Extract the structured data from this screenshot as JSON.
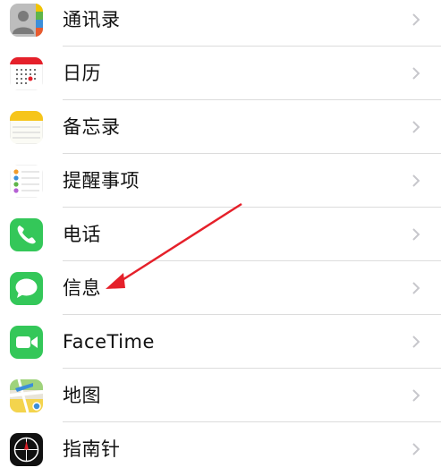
{
  "settings": {
    "items": [
      {
        "label": "通讯录",
        "icon": "contacts-icon"
      },
      {
        "label": "日历",
        "icon": "calendar-icon"
      },
      {
        "label": "备忘录",
        "icon": "notes-icon"
      },
      {
        "label": "提醒事项",
        "icon": "reminders-icon"
      },
      {
        "label": "电话",
        "icon": "phone-icon"
      },
      {
        "label": "信息",
        "icon": "messages-icon"
      },
      {
        "label": "FaceTime",
        "icon": "facetime-icon"
      },
      {
        "label": "地图",
        "icon": "maps-icon"
      },
      {
        "label": "指南针",
        "icon": "compass-icon"
      }
    ]
  },
  "colors": {
    "accent_red": "#e5202a",
    "green": "#34c759",
    "separator": "#dcdcdc",
    "chevron": "#c7c7cc"
  }
}
